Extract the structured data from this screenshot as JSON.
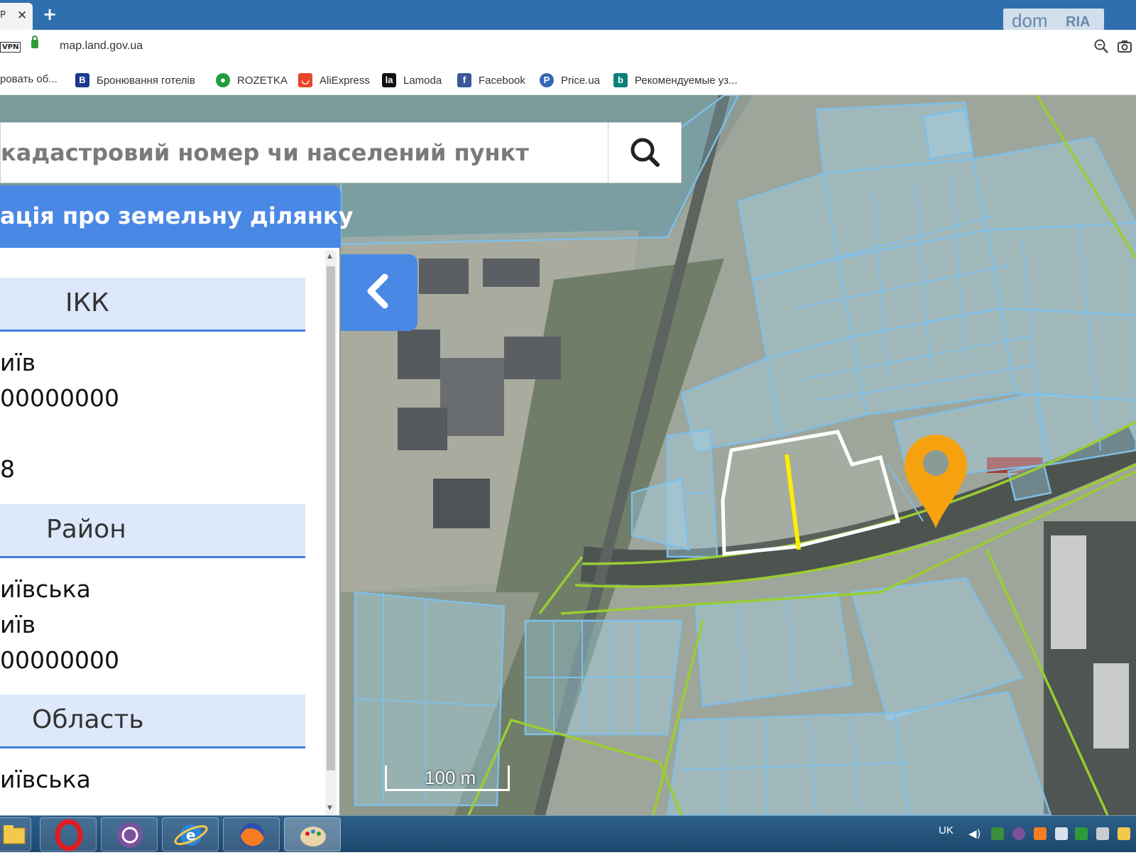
{
  "browser": {
    "tab_label": "Р",
    "new_tab": "+",
    "url": "map.land.gov.ua",
    "vpn_badge": "VPN",
    "watermark_left": "dom",
    "watermark_right": "RIA",
    "bookmarks": [
      {
        "label": "ровать об...",
        "icon": "bookmark-icon",
        "color": "#ffffff"
      },
      {
        "label": "Бронювання готелів",
        "icon": "booking-icon",
        "color": "#1a3a8f"
      },
      {
        "label": "ROZETKA",
        "icon": "rozetka-icon",
        "color": "#1f9e3f"
      },
      {
        "label": "AliExpress",
        "icon": "aliexpress-icon",
        "color": "#e8442a"
      },
      {
        "label": "Lamoda",
        "icon": "lamoda-icon",
        "color": "#111111"
      },
      {
        "label": "Facebook",
        "icon": "facebook-icon",
        "color": "#3b5998"
      },
      {
        "label": "Price.ua",
        "icon": "price-icon",
        "color": "#3468b5"
      },
      {
        "label": "Рекомендуемые уз...",
        "icon": "bing-icon",
        "color": "#0b7f7a"
      }
    ]
  },
  "search": {
    "placeholder": "кадастровий номер чи населений пункт"
  },
  "panel": {
    "title": "ація про земельну ділянку",
    "sections": [
      {
        "label": "ІКК",
        "values": [
          "иїв",
          "00000000",
          "",
          "8"
        ]
      },
      {
        "label": "Район",
        "values": [
          "иївська",
          "иїв",
          "00000000"
        ]
      },
      {
        "label": "Область",
        "values": [
          "иївська"
        ]
      }
    ]
  },
  "map": {
    "scale_label": "100 m",
    "accent_color": "#4a88e6",
    "marker_color": "#f6a20f",
    "parcel_outline_color": "#7fbfe6",
    "boundary_color": "#9acd32",
    "selected_color": "#ffffff",
    "divider_color": "#ffee00"
  },
  "taskbar": {
    "language": "UK",
    "apps": [
      "explorer-icon",
      "opera-icon",
      "viber-icon",
      "ie-icon",
      "firefox-icon",
      "paint-icon"
    ]
  }
}
